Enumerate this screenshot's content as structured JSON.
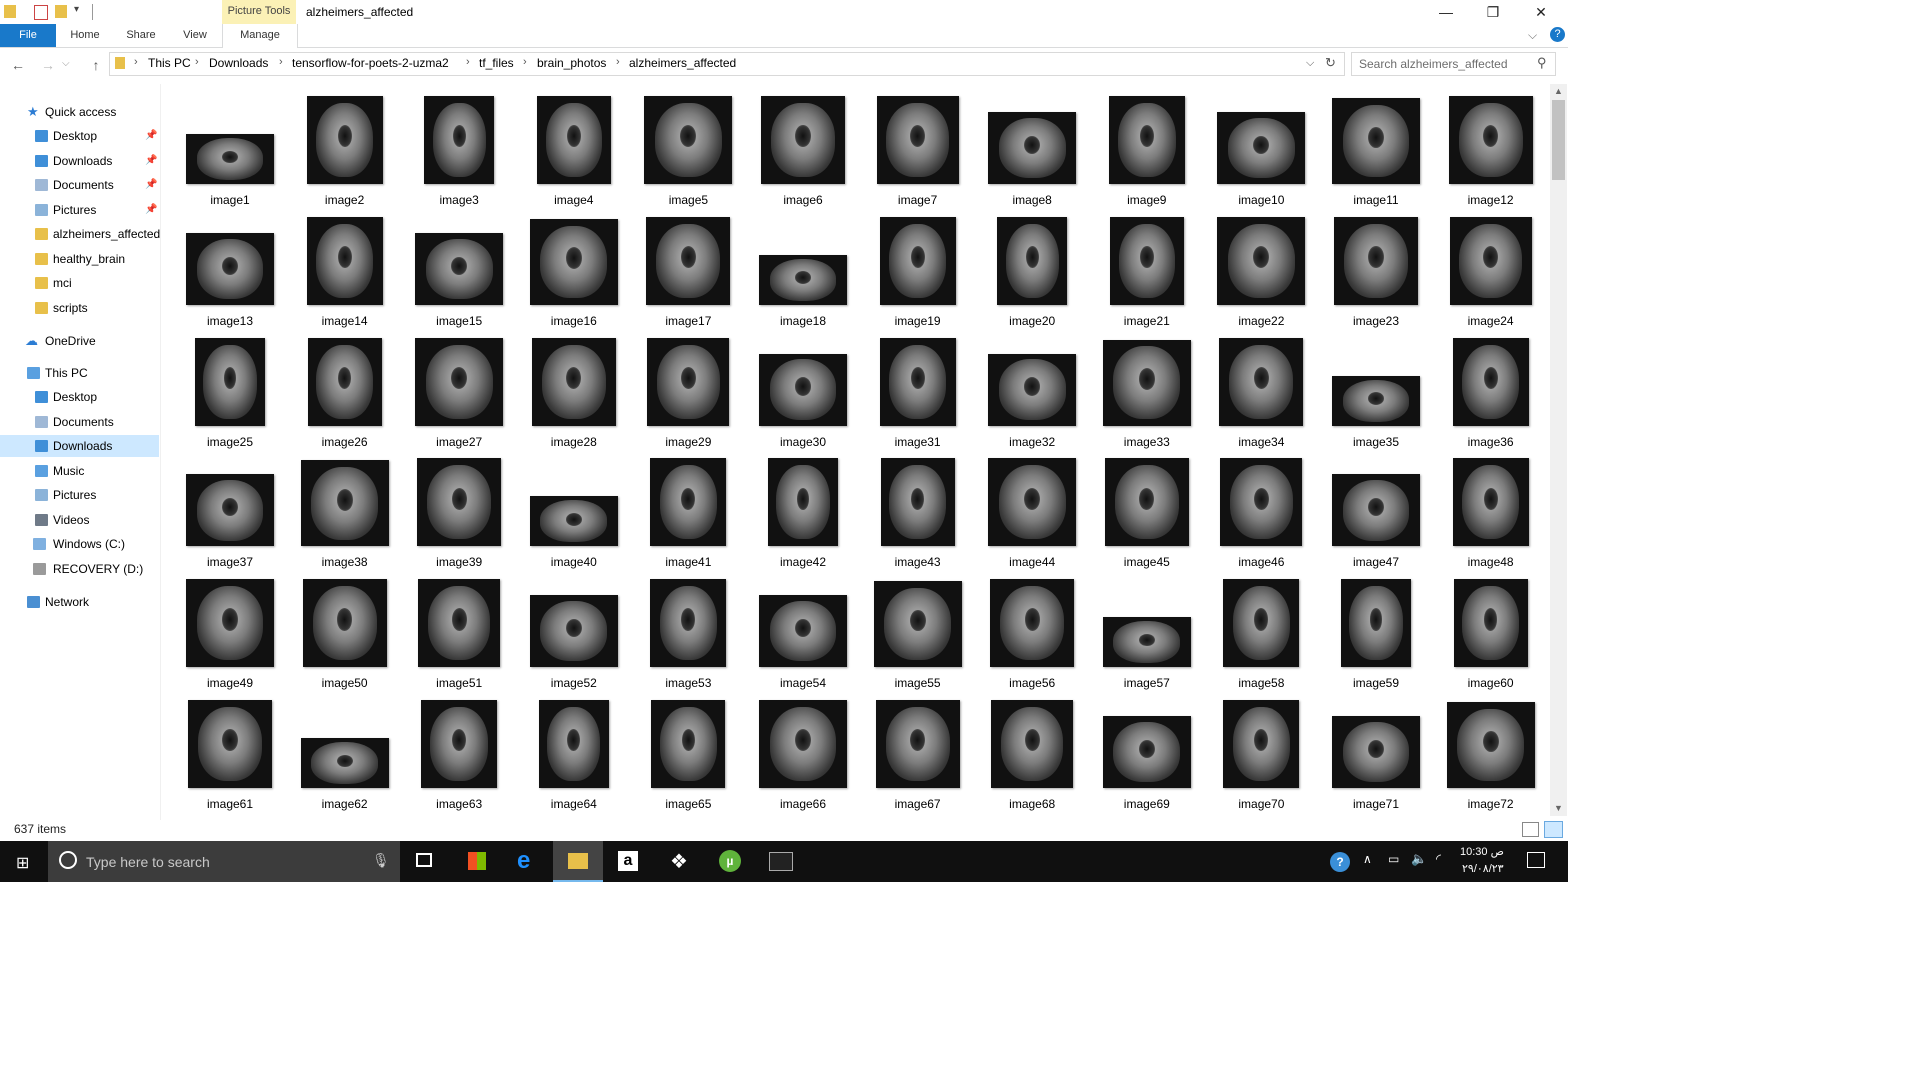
{
  "window": {
    "title": "alzheimers_affected",
    "context_tab": "Picture Tools",
    "minimize": "—",
    "maximize": "❐",
    "close": "✕"
  },
  "ribbon": {
    "tabs": [
      "File",
      "Home",
      "Share",
      "View",
      "Manage"
    ],
    "help": "?"
  },
  "address": {
    "crumbs": [
      "This PC",
      "Downloads",
      "tensorflow-for-poets-2-uzma2",
      "tf_files",
      "brain_photos",
      "alzheimers_affected"
    ],
    "search_placeholder": "Search alzheimers_affected"
  },
  "nav": {
    "quick_access": "Quick access",
    "quick_items": [
      "Desktop",
      "Downloads",
      "Documents",
      "Pictures",
      "alzheimers_affected",
      "healthy_brain",
      "mci",
      "scripts"
    ],
    "onedrive": "OneDrive",
    "this_pc": "This PC",
    "pc_items": [
      "Desktop",
      "Documents",
      "Downloads",
      "Music",
      "Pictures",
      "Videos",
      "Windows (C:)",
      "RECOVERY (D:)"
    ],
    "network": "Network"
  },
  "files": [
    "image1",
    "image2",
    "image3",
    "image4",
    "image5",
    "image6",
    "image7",
    "image8",
    "image9",
    "image10",
    "image11",
    "image12",
    "image13",
    "image14",
    "image15",
    "image16",
    "image17",
    "image18",
    "image19",
    "image20",
    "image21",
    "image22",
    "image23",
    "image24",
    "image25",
    "image26",
    "image27",
    "image28",
    "image29",
    "image30",
    "image31",
    "image32",
    "image33",
    "image34",
    "image35",
    "image36",
    "image37",
    "image38",
    "image39",
    "image40",
    "image41",
    "image42",
    "image43",
    "image44",
    "image45",
    "image46",
    "image47",
    "image48",
    "image49",
    "image50",
    "image51",
    "image52",
    "image53",
    "image54",
    "image55",
    "image56",
    "image57",
    "image58",
    "image59",
    "image60",
    "image61",
    "image62",
    "image63",
    "image64",
    "image65",
    "image66",
    "image67",
    "image68",
    "image69",
    "image70",
    "image71",
    "image72"
  ],
  "status": {
    "item_count": "637 items"
  },
  "taskbar": {
    "search_placeholder": "Type here to search",
    "time": "10:30 ص",
    "date": "۲۹/۰۸/۲۳"
  }
}
